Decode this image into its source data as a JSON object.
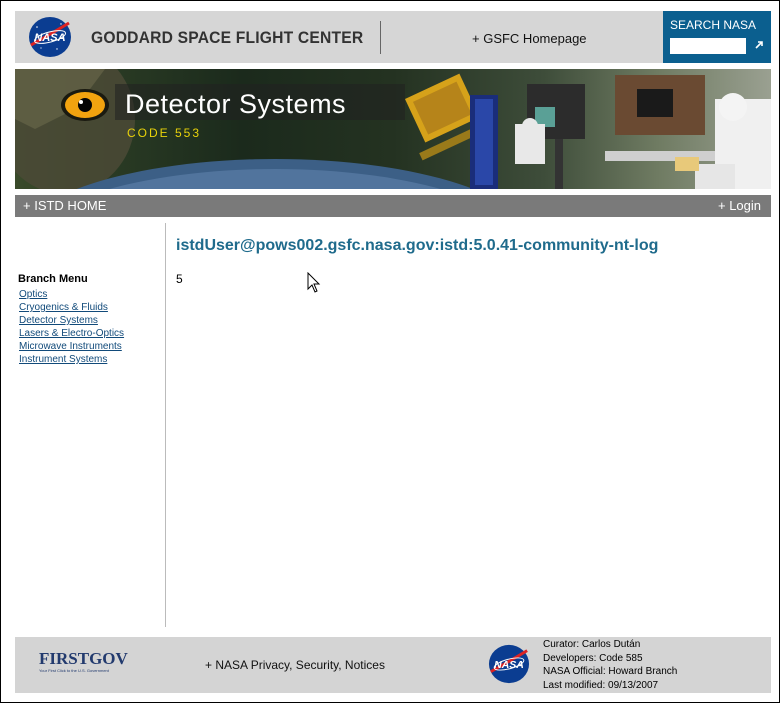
{
  "header": {
    "logo_text": "NASA",
    "org_title": "GODDARD SPACE FLIGHT CENTER",
    "gsfc_link": "+ GSFC Homepage",
    "search_label": "SEARCH NASA",
    "search_value": "",
    "search_go_icon": "arrow-icon"
  },
  "banner": {
    "title": "Detector Systems",
    "code": "CODE 553"
  },
  "nav": {
    "home": "+ ISTD HOME",
    "login": "+ Login"
  },
  "sidebar": {
    "title": "Branch Menu",
    "items": [
      {
        "label": "Optics"
      },
      {
        "label": "Cryogenics & Fluids"
      },
      {
        "label": "Detector Systems"
      },
      {
        "label": "Lasers & Electro-Optics"
      },
      {
        "label": "Microwave Instruments"
      },
      {
        "label": "Instrument Systems"
      }
    ]
  },
  "main": {
    "heading": "istdUser@pows002.gsfc.nasa.gov:istd:5.0.41-community-nt-log",
    "value": "5"
  },
  "footer": {
    "firstgov_logo": "FIRSTGOV",
    "firstgov_tagline": "Your First Click to the U.S. Government",
    "privacy_link": "+ NASA Privacy, Security, Notices",
    "logo_text": "NASA",
    "curator": "Curator: Carlos Dután",
    "developers": "Developers: Code 585",
    "official": "NASA Official: Howard Branch",
    "modified": "Last modified: 09/13/2007"
  },
  "colors": {
    "search_bg": "#0b5f8f",
    "heading": "#1f6b8c",
    "navbar": "#7a7a7a",
    "link": "#114a7a"
  }
}
